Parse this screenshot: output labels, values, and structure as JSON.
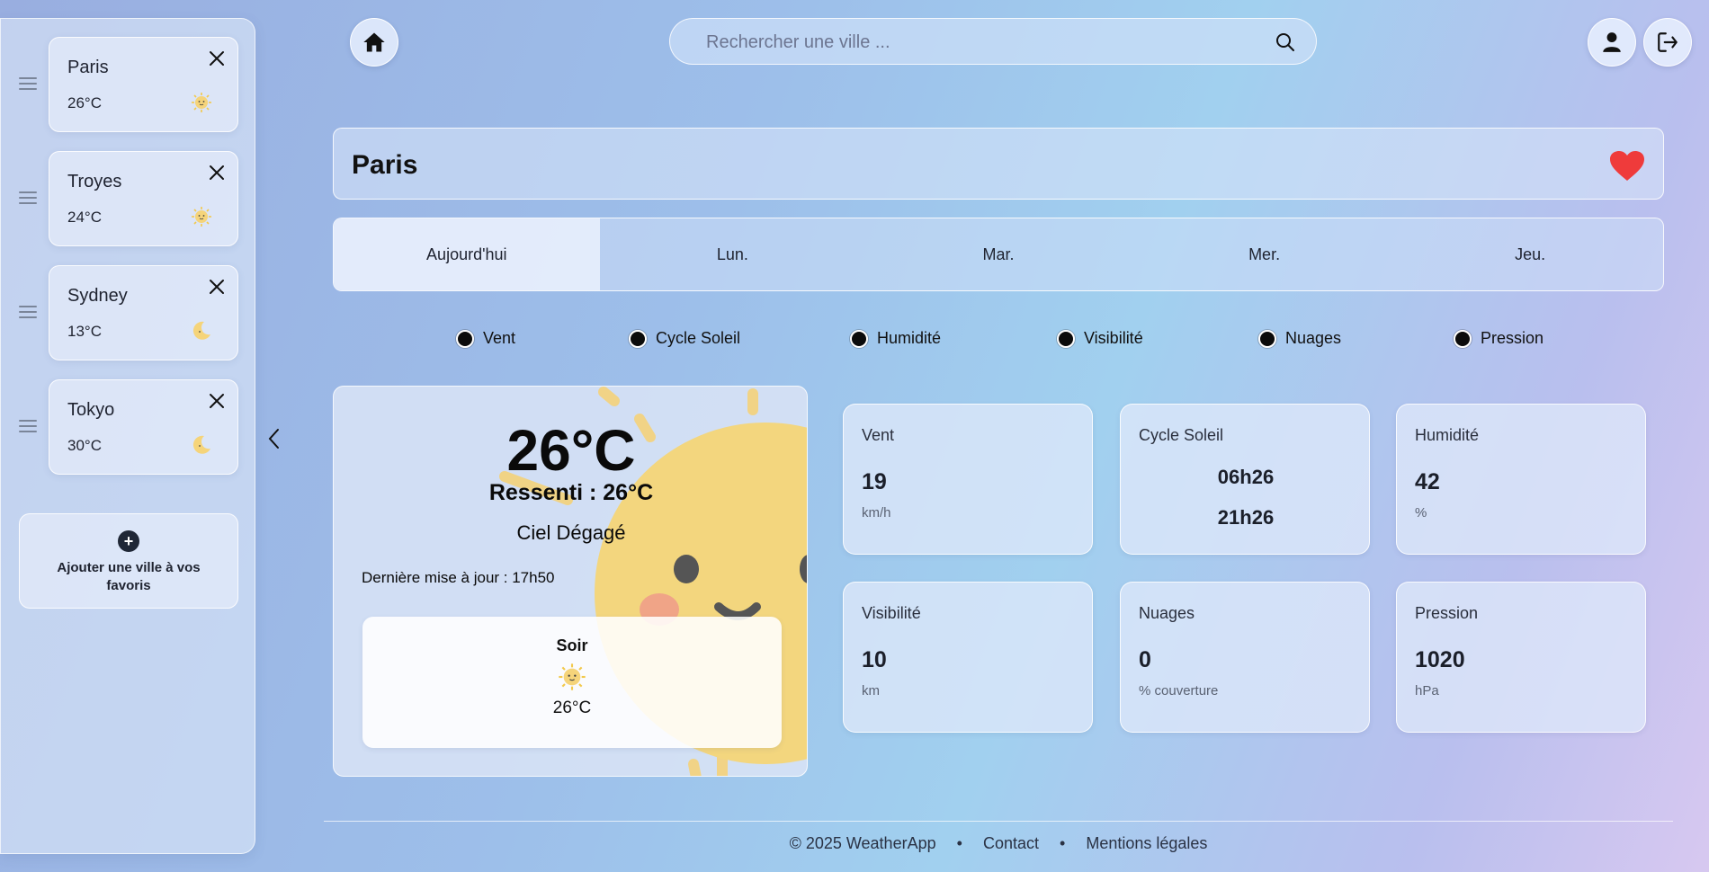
{
  "sidebar": {
    "favorites": [
      {
        "name": "Paris",
        "temp": "26°C",
        "icon": "sun-icon"
      },
      {
        "name": "Troyes",
        "temp": "24°C",
        "icon": "sun-icon"
      },
      {
        "name": "Sydney",
        "temp": "13°C",
        "icon": "moon-icon"
      },
      {
        "name": "Tokyo",
        "temp": "30°C",
        "icon": "moon-icon"
      }
    ],
    "add_label": "Ajouter une ville à vos favoris"
  },
  "search": {
    "placeholder": "Rechercher une ville ..."
  },
  "city": {
    "name": "Paris",
    "favorite": true
  },
  "tabs": [
    "Aujourd'hui",
    "Lun.",
    "Mar.",
    "Mer.",
    "Jeu."
  ],
  "active_tab": "Aujourd'hui",
  "toggles": [
    "Vent",
    "Cycle Soleil",
    "Humidité",
    "Visibilité",
    "Nuages",
    "Pression"
  ],
  "current": {
    "temp": "26°C",
    "feels_like": "Ressenti : 26°C",
    "description": "Ciel Dégagé",
    "updated": "Dernière mise à jour : 17h50",
    "evening": {
      "label": "Soir",
      "temp": "26°C",
      "icon": "sun-icon"
    }
  },
  "details": {
    "wind": {
      "title": "Vent",
      "value": "19",
      "unit": "km/h"
    },
    "sun_cycle": {
      "title": "Cycle Soleil",
      "sunrise": "06h26",
      "sunset": "21h26"
    },
    "humidity": {
      "title": "Humidité",
      "value": "42",
      "unit": "%"
    },
    "visibility": {
      "title": "Visibilité",
      "value": "10",
      "unit": "km"
    },
    "clouds": {
      "title": "Nuages",
      "value": "0",
      "unit": "% couverture"
    },
    "pressure": {
      "title": "Pression",
      "value": "1020",
      "unit": "hPa"
    }
  },
  "footer": {
    "copyright": "© 2025 WeatherApp",
    "contact": "Contact",
    "legal": "Mentions légales",
    "separator": "•"
  },
  "colors": {
    "heart": "#ef3b3b",
    "sun": "#f2d27a",
    "accent_dark": "#1f2736"
  }
}
